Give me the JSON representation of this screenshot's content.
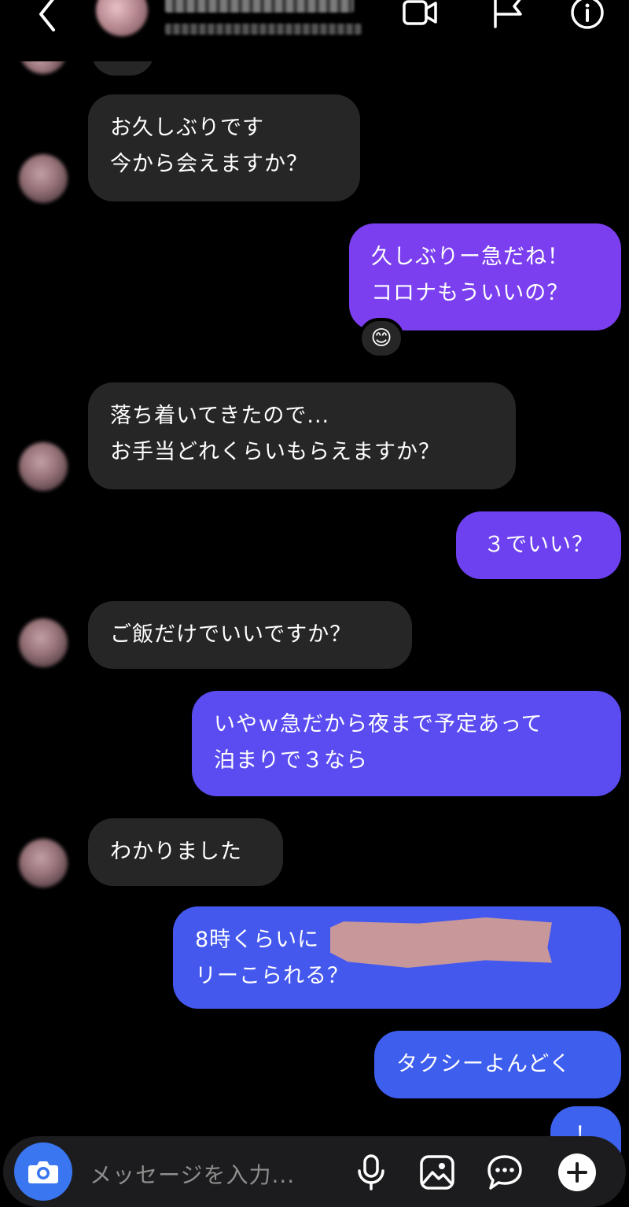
{
  "chat": {
    "messages": [
      {
        "from": "them",
        "text": "お久しぶりです\n今から会えますか？"
      },
      {
        "from": "me",
        "text": "久しぶりー急だね！\nコロナもういいの？",
        "reaction": "😊"
      },
      {
        "from": "them",
        "text": "落ち着いてきたので...\nお手当どれくらいもらえますか？"
      },
      {
        "from": "me",
        "text": "３でいい？"
      },
      {
        "from": "them",
        "text": "ご飯だけでいいですか？"
      },
      {
        "from": "me",
        "text": "いやｗ急だから夜まで予定あって\n泊まりで３なら"
      },
      {
        "from": "them",
        "text": "わかりました"
      },
      {
        "from": "me",
        "text": "8時くらいに　　　　　　　　ータ\nリーこられる？"
      },
      {
        "from": "me",
        "text": "タクシーよんどく"
      },
      {
        "from": "me",
        "text": "！"
      }
    ]
  },
  "composer": {
    "placeholder": "メッセージを入力..."
  },
  "colors": {
    "incoming_bubble": "#262626",
    "outgoing_bubble_top": "#7b3ff0",
    "outgoing_bubble_bottom": "#3a63ee",
    "camera_button": "#3a76f0"
  },
  "icons": [
    "back-chevron-icon",
    "video-call-icon",
    "flag-icon",
    "info-icon",
    "camera-icon",
    "microphone-icon",
    "gallery-icon",
    "sticker-icon",
    "plus-icon"
  ]
}
